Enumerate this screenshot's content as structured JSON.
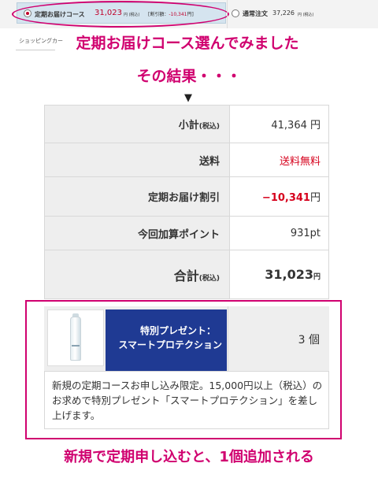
{
  "course_options": {
    "teiki": {
      "label": "定期お届けコース",
      "price": "31,023",
      "tax_note": "円 (税込)",
      "discount_label": "[割引額：",
      "discount_value": "-10,341",
      "discount_suffix": "円]"
    },
    "normal": {
      "label": "通常注文",
      "price": "37,226",
      "tax_note": "円 (税込)"
    }
  },
  "cart_tab": {
    "label": "ショッピングカー"
  },
  "annotations": {
    "line1": "定期お届けコース選んでみました",
    "line2": "その結果・・・",
    "arrow": "▼",
    "bottom": "新規で定期申し込むと、1個追加される"
  },
  "summary": {
    "subtotal": {
      "label": "小計",
      "label_suffix": "(税込)",
      "value": "41,364 円"
    },
    "shipping": {
      "label": "送料",
      "value": "送料無料"
    },
    "discount": {
      "label": "定期お届け割引",
      "value": "−10,341",
      "unit": "円"
    },
    "points": {
      "label": "今回加算ポイント",
      "value": "931pt"
    },
    "total": {
      "label": "合計",
      "label_suffix": "(税込)",
      "value": "31,023",
      "unit": "円"
    }
  },
  "gift": {
    "title_line1": "特別プレゼント：",
    "title_line2": "スマートプロテクション",
    "quantity": "3 個",
    "note": "新規の定期コースお申し込み限定。15,000円以上（税込）のお求めで特別プレゼント「スマートプロテクション」を差し上げます。"
  },
  "colors": {
    "annotation": "#d0006f",
    "price_red": "#d6001c",
    "gift_banner": "#1f3a93"
  }
}
